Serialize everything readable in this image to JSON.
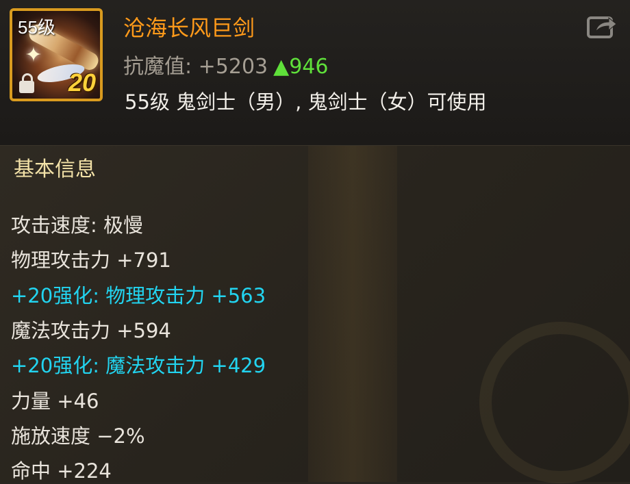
{
  "item": {
    "level_tag": "55级",
    "enhance": "20",
    "name": "沧海长风巨剑",
    "resist_label": "抗魔值: +5203",
    "resist_delta": "▲946",
    "usable_text": "55级 鬼剑士（男）, 鬼剑士（女）可使用"
  },
  "section": {
    "title": "基本信息"
  },
  "stats": [
    {
      "text": "攻击速度: 极慢",
      "color": "white"
    },
    {
      "text": "物理攻击力 +791",
      "color": "white"
    },
    {
      "text": "+20强化: 物理攻击力 +563",
      "color": "cyan"
    },
    {
      "text": "魔法攻击力 +594",
      "color": "white"
    },
    {
      "text": "+20强化: 魔法攻击力 +429",
      "color": "cyan"
    },
    {
      "text": "力量 +46",
      "color": "white"
    },
    {
      "text": "施放速度 −2%",
      "color": "white"
    },
    {
      "text": "命中 +224",
      "color": "white"
    }
  ],
  "icons": {
    "share": "share-icon",
    "lock": "lock-icon"
  },
  "colors": {
    "name": "#ff9a1a",
    "delta_up": "#5fe03a",
    "enhance_text": "#22d4f0",
    "section_title": "#f3e2a8",
    "icon_border": "#d99b1f"
  }
}
